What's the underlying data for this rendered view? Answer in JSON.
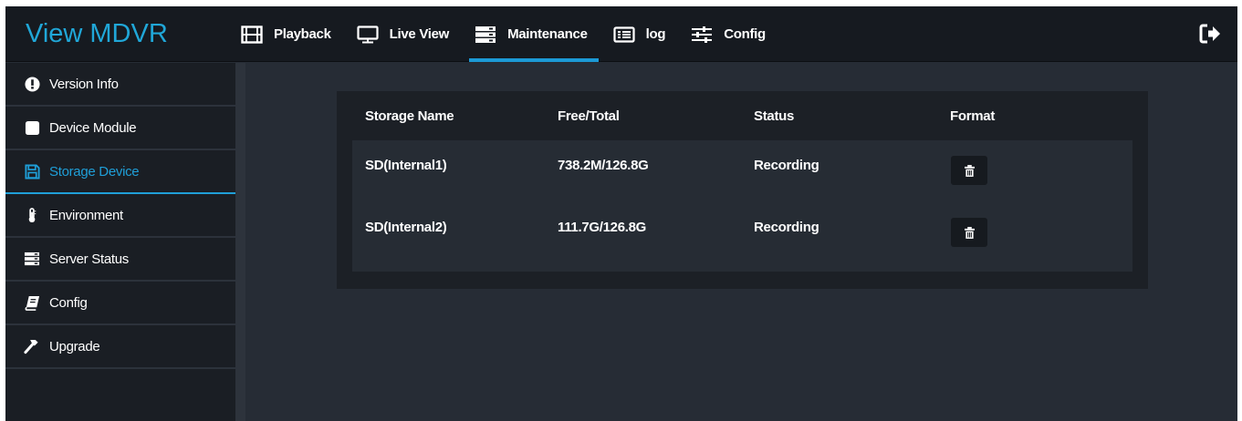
{
  "app": {
    "title": "View MDVR"
  },
  "nav": {
    "items": [
      {
        "label": "Playback",
        "icon": "film-icon"
      },
      {
        "label": "Live View",
        "icon": "monitor-icon"
      },
      {
        "label": "Maintenance",
        "icon": "server-icon",
        "active": true
      },
      {
        "label": "log",
        "icon": "list-icon"
      },
      {
        "label": "Config",
        "icon": "sliders-icon"
      }
    ],
    "logout_icon": "sign-out-icon"
  },
  "sidebar": {
    "items": [
      {
        "label": "Version Info",
        "icon": "exclamation-circle-icon"
      },
      {
        "label": "Device Module",
        "icon": "square-icon"
      },
      {
        "label": "Storage Device",
        "icon": "floppy-disk-icon",
        "active": true
      },
      {
        "label": "Environment",
        "icon": "thermometer-icon"
      },
      {
        "label": "Server Status",
        "icon": "server-icon"
      },
      {
        "label": "Config",
        "icon": "book-icon"
      },
      {
        "label": "Upgrade",
        "icon": "hammer-icon"
      }
    ]
  },
  "storage": {
    "headers": {
      "name": "Storage Name",
      "free_total": "Free/Total",
      "status": "Status",
      "format": "Format"
    },
    "rows": [
      {
        "name": "SD(Internal1)",
        "free_total": "738.2M/126.8G",
        "status": "Recording"
      },
      {
        "name": "SD(Internal2)",
        "free_total": "111.7G/126.8G",
        "status": "Recording"
      }
    ],
    "format_icon": "trash-icon"
  },
  "colors": {
    "accent": "#1c9ad6",
    "brand": "#20a7d8",
    "topbar_bg": "#161a20",
    "sidebar_bg": "#1a1e24",
    "content_bg": "#262c35"
  }
}
